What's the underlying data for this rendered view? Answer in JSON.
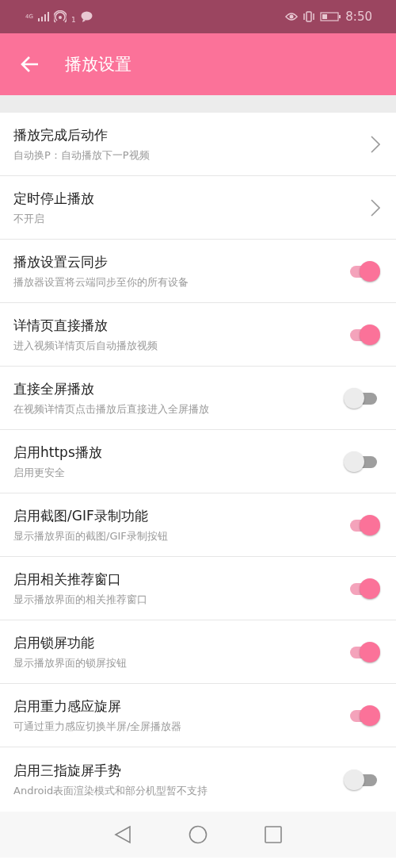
{
  "status_bar": {
    "network": "4G",
    "notification_count": "1",
    "time": "8:50"
  },
  "app_bar": {
    "title": "播放设置"
  },
  "settings": [
    {
      "kind": "link",
      "title": "播放完成后动作",
      "subtitle": "自动换P：自动播放下一P视频"
    },
    {
      "kind": "link",
      "title": "定时停止播放",
      "subtitle": "不开启"
    },
    {
      "kind": "toggle",
      "title": "播放设置云同步",
      "subtitle": "播放器设置将云端同步至你的所有设备",
      "on": true
    },
    {
      "kind": "toggle",
      "title": "详情页直接播放",
      "subtitle": "进入视频详情页后自动播放视频",
      "on": true
    },
    {
      "kind": "toggle",
      "title": "直接全屏播放",
      "subtitle": "在视频详情页点击播放后直接进入全屏播放",
      "on": false
    },
    {
      "kind": "toggle",
      "title": "启用https播放",
      "subtitle": "启用更安全",
      "on": false
    },
    {
      "kind": "toggle",
      "title": "启用截图/GIF录制功能",
      "subtitle": "显示播放界面的截图/GIF录制按钮",
      "on": true
    },
    {
      "kind": "toggle",
      "title": "启用相关推荐窗口",
      "subtitle": "显示播放界面的相关推荐窗口",
      "on": true
    },
    {
      "kind": "toggle",
      "title": "启用锁屏功能",
      "subtitle": "显示播放界面的锁屏按钮",
      "on": true
    },
    {
      "kind": "toggle",
      "title": "启用重力感应旋屏",
      "subtitle": "可通过重力感应切换半屏/全屏播放器",
      "on": true
    },
    {
      "kind": "toggle",
      "title": "启用三指旋屏手势",
      "subtitle": "Android表面渲染模式和部分机型暂不支持",
      "on": false
    }
  ]
}
